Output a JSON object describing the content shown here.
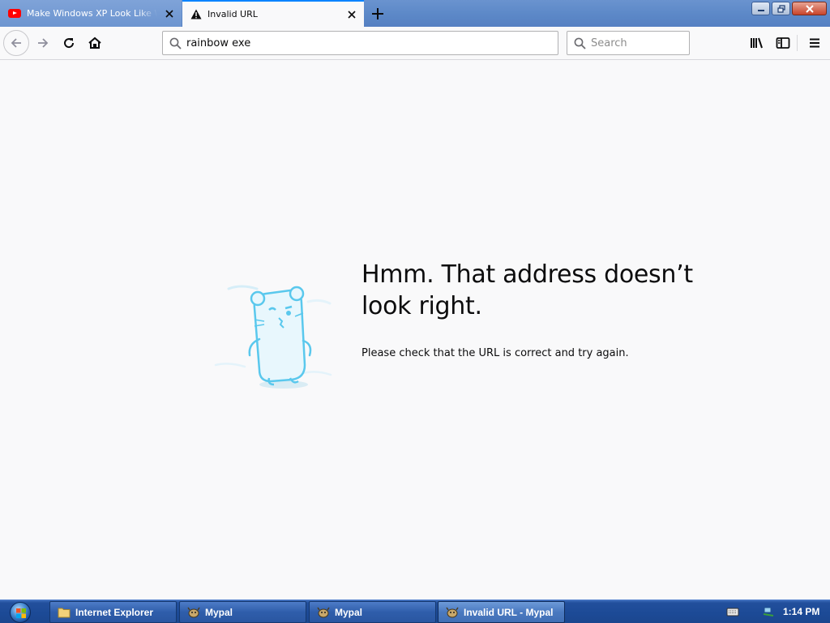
{
  "tabs": [
    {
      "label": "Make Windows XP Look Like Wi",
      "icon": "youtube-icon",
      "active": false
    },
    {
      "label": "Invalid URL",
      "icon": "warning-icon",
      "active": true
    }
  ],
  "navbar": {
    "url_value": "rainbow exe",
    "search_placeholder": "Search"
  },
  "content": {
    "title": "Hmm. That address doesn’t look right.",
    "description": "Please check that the URL is correct and try again."
  },
  "taskbar": {
    "buttons": [
      {
        "label": "Internet Explorer",
        "icon": "folder-icon"
      },
      {
        "label": "Mypal",
        "icon": "mypal-icon"
      },
      {
        "label": "Mypal",
        "icon": "mypal-icon"
      },
      {
        "label": "Invalid URL - Mypal",
        "icon": "mypal-icon",
        "active": true
      }
    ],
    "clock": "1:14 PM"
  },
  "colors": {
    "accent": "#0a84ff",
    "illustration": "#5ac8ed"
  }
}
